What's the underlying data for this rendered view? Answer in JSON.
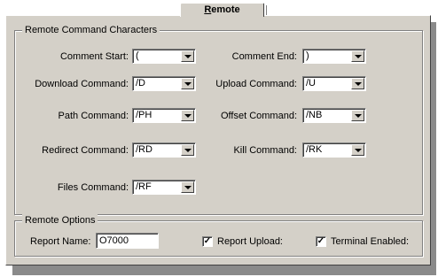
{
  "tab": {
    "label": "Remote",
    "mnemonic": "R",
    "rest": "emote"
  },
  "group_commands": {
    "title": "Remote Command Characters",
    "fields": [
      {
        "label": "Comment Start:",
        "value": "("
      },
      {
        "label": "Comment End:",
        "value": ")"
      },
      {
        "label": "Download Command:",
        "value": "/D"
      },
      {
        "label": "Upload Command:",
        "value": "/U"
      },
      {
        "label": "Path Command:",
        "value": "/PH"
      },
      {
        "label": "Offset Command:",
        "value": "/NB"
      },
      {
        "label": "Redirect Command:",
        "value": "/RD"
      },
      {
        "label": "Kill Command:",
        "value": "/RK"
      },
      {
        "label": "Files Command:",
        "value": "/RF"
      }
    ]
  },
  "group_options": {
    "title": "Remote Options",
    "report_name_label": "Report Name:",
    "report_name_value": "O7000",
    "report_upload_label": "Report Upload:",
    "report_upload_checked": true,
    "terminal_enabled_label": "Terminal Enabled:",
    "terminal_enabled_checked": true
  }
}
